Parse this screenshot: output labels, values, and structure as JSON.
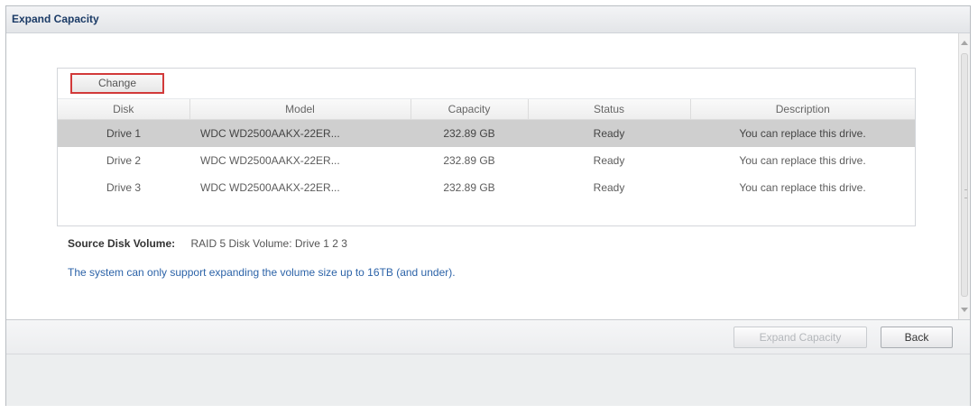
{
  "window": {
    "title": "Expand Capacity"
  },
  "toolbar": {
    "change_label": "Change"
  },
  "table": {
    "columns": [
      "Disk",
      "Model",
      "Capacity",
      "Status",
      "Description"
    ],
    "rows": [
      {
        "disk": "Drive 1",
        "model": "WDC WD2500AAKX-22ER...",
        "capacity": "232.89 GB",
        "status": "Ready",
        "description": "You can replace this drive.",
        "selected": true
      },
      {
        "disk": "Drive 2",
        "model": "WDC WD2500AAKX-22ER...",
        "capacity": "232.89 GB",
        "status": "Ready",
        "description": "You can replace this drive.",
        "selected": false
      },
      {
        "disk": "Drive 3",
        "model": "WDC WD2500AAKX-22ER...",
        "capacity": "232.89 GB",
        "status": "Ready",
        "description": "You can replace this drive.",
        "selected": false
      }
    ]
  },
  "source": {
    "label": "Source Disk Volume:",
    "value": "RAID 5 Disk Volume: Drive 1 2 3"
  },
  "notice": "The system can only support expanding the volume size up to 16TB (and under).",
  "buttons": {
    "expand_label": "Expand Capacity",
    "back_label": "Back"
  },
  "colors": {
    "highlight_border": "#d23a3a",
    "notice_text": "#2c63a8",
    "selected_row": "#cfcfcf"
  }
}
